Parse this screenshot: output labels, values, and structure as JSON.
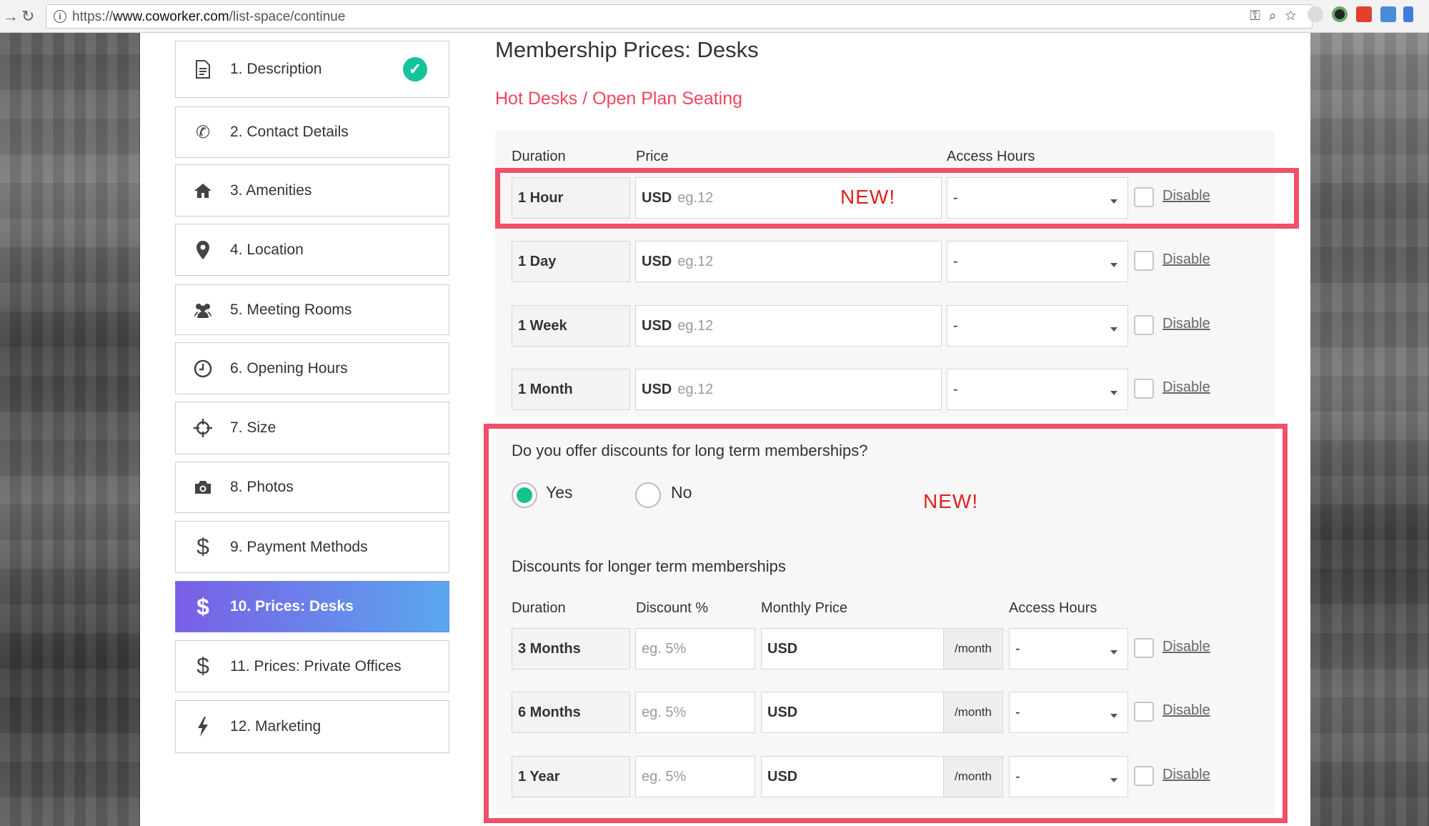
{
  "browser": {
    "url_prefix": "https://",
    "url_host": "www.coworker.com",
    "url_path": "/list-space/continue",
    "reload_icon": "reload-icon",
    "star_icon": "star-icon"
  },
  "sidebar": {
    "items": [
      {
        "label": "1. Description",
        "icon": "document-icon",
        "done": true
      },
      {
        "label": "2. Contact Details",
        "icon": "phone-icon"
      },
      {
        "label": "3. Amenities",
        "icon": "home-icon"
      },
      {
        "label": "4. Location",
        "icon": "map-pin-icon"
      },
      {
        "label": "5. Meeting Rooms",
        "icon": "people-icon"
      },
      {
        "label": "6. Opening Hours",
        "icon": "clock-icon"
      },
      {
        "label": "7. Size",
        "icon": "crosshair-icon"
      },
      {
        "label": "8. Photos",
        "icon": "camera-icon"
      },
      {
        "label": "9. Payment Methods",
        "icon": "dollar-icon"
      },
      {
        "label": "10. Prices: Desks",
        "icon": "dollar-icon",
        "active": true
      },
      {
        "label": "11. Prices: Private Offices",
        "icon": "dollar-icon"
      },
      {
        "label": "12. Marketing",
        "icon": "lightning-icon"
      }
    ]
  },
  "main": {
    "title": "Membership Prices: Desks",
    "subtitle": "Hot Desks / Open Plan Seating",
    "headers": {
      "duration": "Duration",
      "price": "Price",
      "access": "Access Hours"
    },
    "rows": [
      {
        "duration": "1 Hour",
        "currency": "USD",
        "placeholder": "eg.12",
        "access": "-",
        "disable": "Disable"
      },
      {
        "duration": "1 Day",
        "currency": "USD",
        "placeholder": "eg.12",
        "access": "-",
        "disable": "Disable"
      },
      {
        "duration": "1 Week",
        "currency": "USD",
        "placeholder": "eg.12",
        "access": "-",
        "disable": "Disable"
      },
      {
        "duration": "1 Month",
        "currency": "USD",
        "placeholder": "eg.12",
        "access": "-",
        "disable": "Disable"
      }
    ],
    "new_tag_1": "NEW!",
    "discount": {
      "question": "Do you offer discounts for long term memberships?",
      "yes": "Yes",
      "no": "No",
      "selected": "Yes",
      "new_tag": "NEW!",
      "section_title": "Discounts for longer term memberships",
      "headers": {
        "duration": "Duration",
        "discount": "Discount %",
        "monthly": "Monthly Price",
        "access": "Access Hours"
      },
      "rows": [
        {
          "duration": "3 Months",
          "placeholder": "eg. 5%",
          "currency": "USD",
          "suffix": "/month",
          "access": "-",
          "disable": "Disable"
        },
        {
          "duration": "6 Months",
          "placeholder": "eg. 5%",
          "currency": "USD",
          "suffix": "/month",
          "access": "-",
          "disable": "Disable"
        },
        {
          "duration": "1 Year",
          "placeholder": "eg. 5%",
          "currency": "USD",
          "suffix": "/month",
          "access": "-",
          "disable": "Disable"
        }
      ]
    }
  },
  "colors": {
    "accent_red": "#f0465c",
    "highlight_box": "#f0506a",
    "success": "#15c39a",
    "active_from": "#7a5ee6",
    "active_to": "#5aa7ee"
  }
}
